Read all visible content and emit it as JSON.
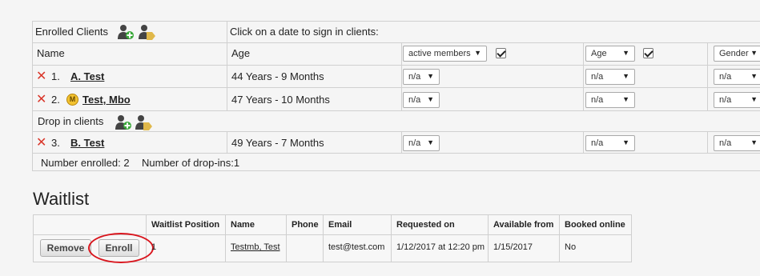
{
  "enrolled": {
    "title": "Enrolled Clients",
    "instruction": "Click on a date to sign in clients:",
    "col_name": "Name",
    "col_age": "Age",
    "filters": [
      {
        "label": "active members"
      },
      {
        "label": "Age"
      },
      {
        "label": "Gender"
      }
    ],
    "rows": [
      {
        "num": "1.",
        "name": "A. Test",
        "age": "44 Years - 9 Months",
        "badge": ""
      },
      {
        "num": "2.",
        "name": "Test, Mbo",
        "age": "47 Years - 10 Months",
        "badge": "M"
      }
    ],
    "dropin_title": "Drop in clients",
    "dropin_rows": [
      {
        "num": "3.",
        "name": "B. Test",
        "age": "49 Years - 7 Months"
      }
    ],
    "na": "n/a",
    "footer_enrolled": "Number enrolled: 2",
    "footer_dropins": "Number of drop-ins:1"
  },
  "waitlist": {
    "title": "Waitlist",
    "headers": [
      "Waitlist Position",
      "Name",
      "Phone",
      "Email",
      "Requested on",
      "Available from",
      "Booked online"
    ],
    "row": {
      "position": "1",
      "name": "Testmb, Test",
      "phone": "",
      "email": "test@test.com",
      "requested": "1/12/2017 at 12:20 pm",
      "available": "1/15/2017",
      "booked": "No"
    },
    "remove_label": "Remove",
    "enroll_label": "Enroll"
  },
  "colors": {
    "accent_circle": "#d9161e",
    "delete_x": "#d9362a",
    "badge": "#f2c230"
  },
  "icons": [
    "add-client-icon",
    "tag-client-icon",
    "delete-x-icon",
    "member-badge-icon",
    "dropdown-arrow-icon",
    "checkbox-checked-icon"
  ]
}
